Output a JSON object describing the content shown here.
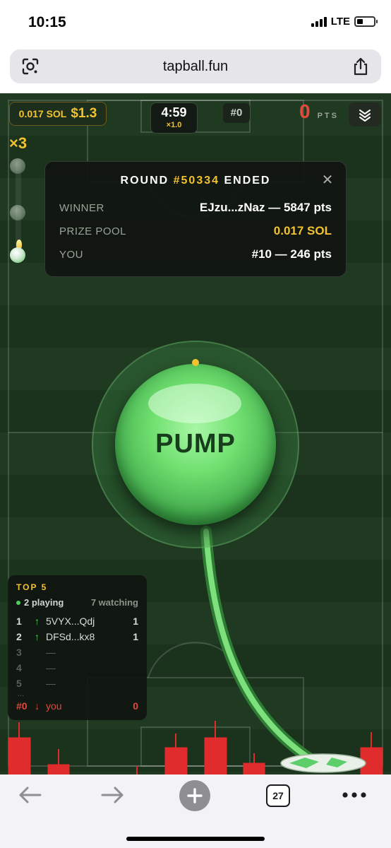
{
  "status_bar": {
    "time": "10:15",
    "network": "LTE"
  },
  "browser": {
    "url": "tapball.fun",
    "tab_count": "27"
  },
  "hud": {
    "sol_amount": "0.017 SOL",
    "sol_usd": "$1.3",
    "timer": "4:59",
    "timer_multiplier": "×1.0",
    "rank": "#0",
    "points": "0",
    "points_label": "PTS",
    "combo_multiplier": "×3"
  },
  "round_modal": {
    "title_prefix": "ROUND ",
    "round_number": "#50334",
    "title_suffix": " ENDED",
    "close_glyph": "✕",
    "rows": [
      {
        "label": "WINNER",
        "value": "EJzu...zNaz — 5847 pts"
      },
      {
        "label": "PRIZE POOL",
        "value": "0.017 SOL"
      },
      {
        "label": "YOU",
        "value": "#10 — 246 pts"
      }
    ]
  },
  "pump_button": {
    "label": "PUMP"
  },
  "leaderboard": {
    "title": "TOP 5",
    "playing": "2 playing",
    "watching": "7 watching",
    "rows": [
      {
        "rank": "1",
        "arrow": "↑",
        "name": "5VYX...Qdj",
        "score": "1"
      },
      {
        "rank": "2",
        "arrow": "↑",
        "name": "DFSd...kx8",
        "score": "1"
      },
      {
        "rank": "3",
        "arrow": "",
        "name": "—",
        "score": ""
      },
      {
        "rank": "4",
        "arrow": "",
        "name": "—",
        "score": ""
      },
      {
        "rank": "5",
        "arrow": "",
        "name": "—",
        "score": ""
      }
    ],
    "ellipsis": "...",
    "you": {
      "rank": "#0",
      "arrow": "↓",
      "name": "you",
      "score": "0"
    }
  },
  "colors": {
    "accent_gold": "#f2c230",
    "pump_green": "#6fe06f",
    "danger_red": "#e04a3c",
    "field_green": "#203a22"
  }
}
